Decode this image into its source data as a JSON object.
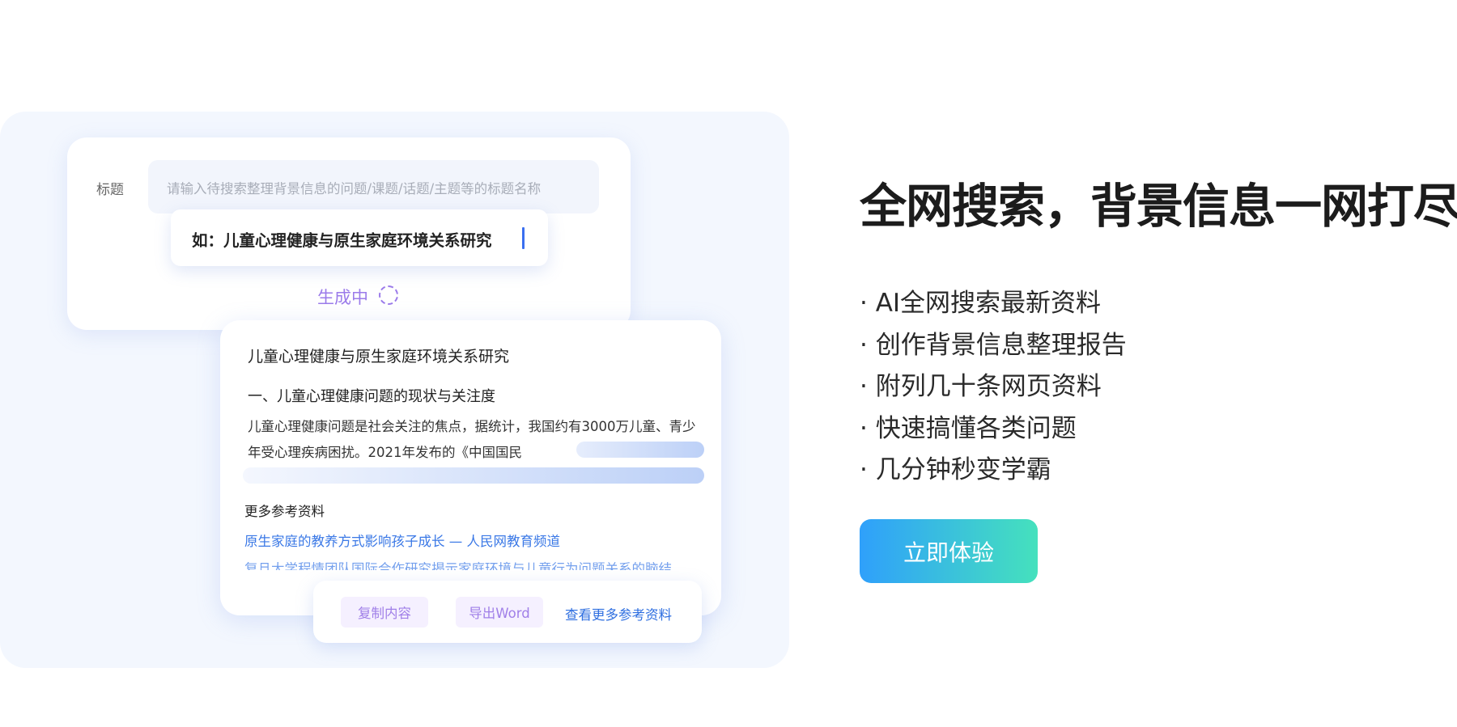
{
  "form": {
    "title_label": "标题",
    "title_placeholder": "请输入待搜索整理背景信息的问题/课题/话题/主题等的标题名称",
    "example_text": "如：儿童心理健康与原生家庭环境关系研究",
    "generating_text": "生成中"
  },
  "result": {
    "doc_title": "儿童心理健康与原生家庭环境关系研究",
    "section_heading": "一、儿童心理健康问题的现状与关注度",
    "paragraph": "儿童心理健康问题是社会关注的焦点，据统计，我国约有3000万儿童、青少年受心理疾病困扰。2021年发布的《中国国民",
    "refs_title": "更多参考资料",
    "refs": [
      "原生家庭的教养方式影响孩子成长 — 人民网教育频道",
      "复旦大学程情团队国际合作研究揭示家庭环境与儿童行为问题关系的脑结"
    ]
  },
  "actions": {
    "copy_label": "复制内容",
    "export_label": "导出Word",
    "more_refs_label": "查看更多参考资料"
  },
  "hero": {
    "headline": "全网搜索，背景信息一网打尽!",
    "features": [
      "· AI全网搜索最新资料",
      "· 创作背景信息整理报告",
      "· 附列几十条网页资料",
      "· 快速搞懂各类问题",
      "· 几分钟秒变学霸"
    ],
    "cta_label": "立即体验"
  },
  "colors": {
    "accent_purple": "#9b7bea",
    "link_blue": "#3a78e6",
    "cta_gradient_start": "#2fa0fb",
    "cta_gradient_end": "#45e1bd"
  }
}
